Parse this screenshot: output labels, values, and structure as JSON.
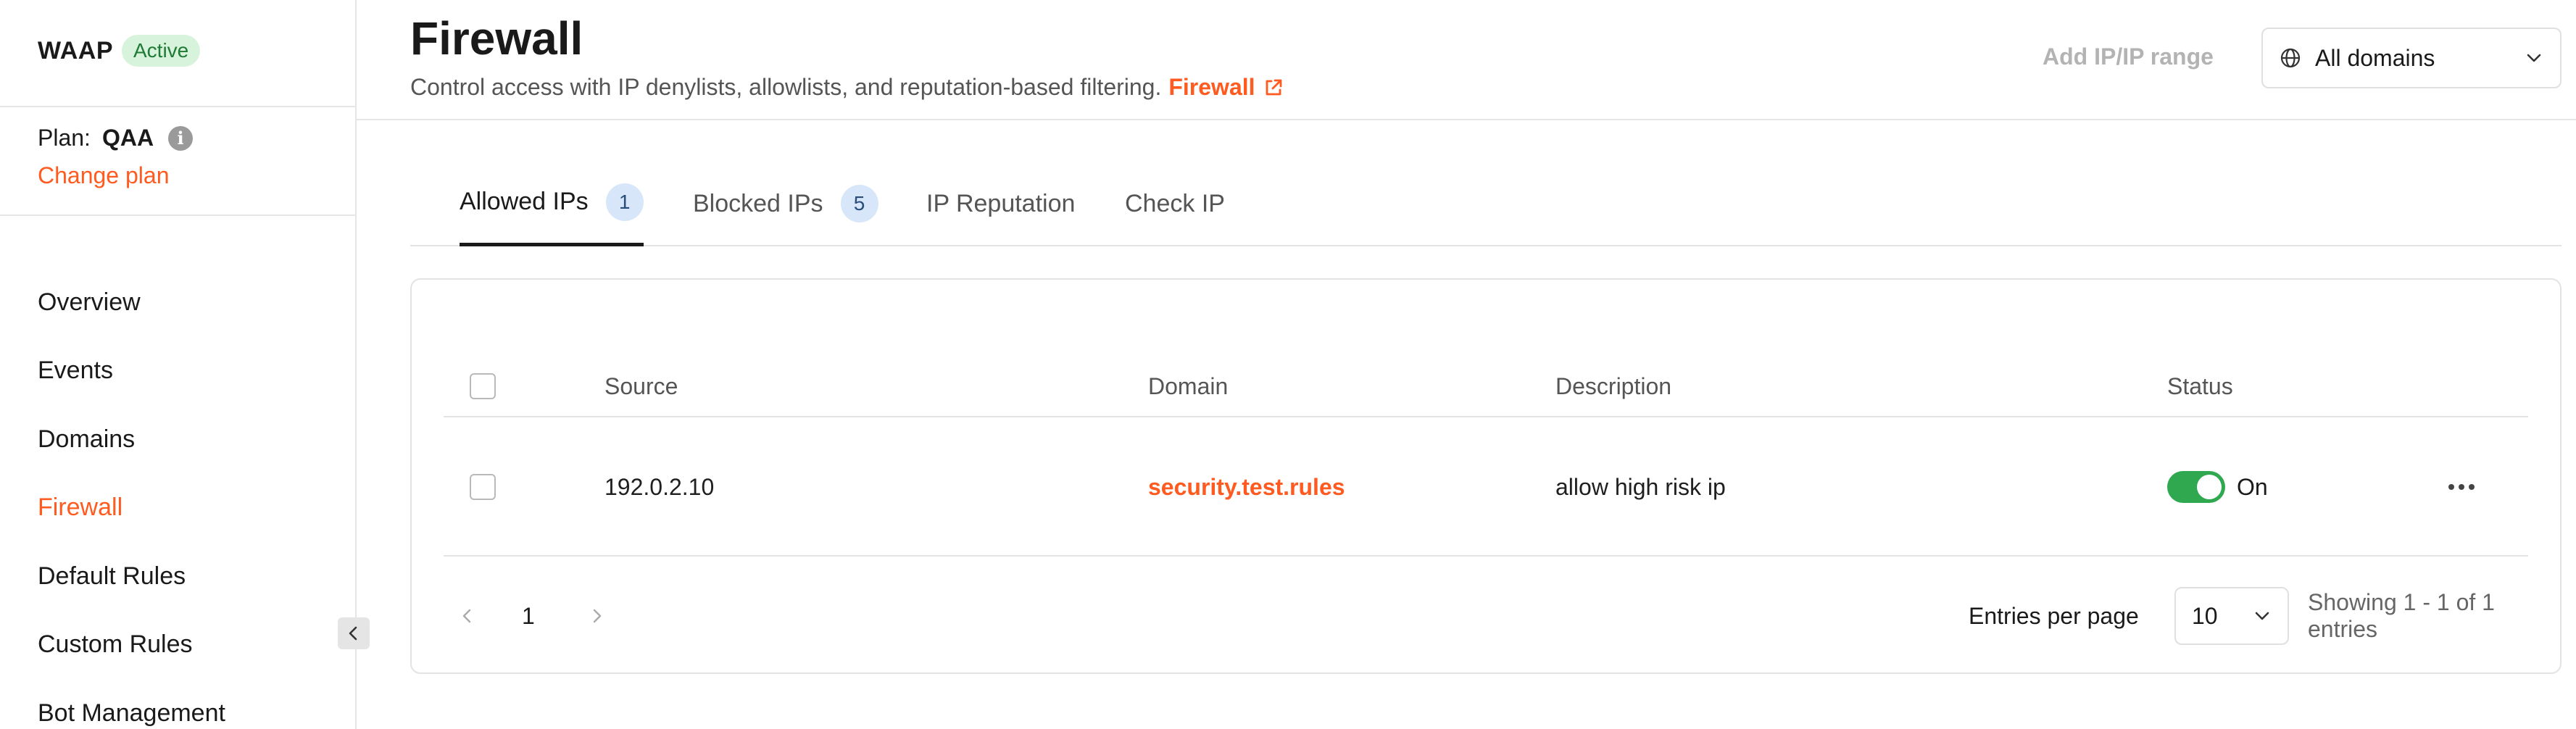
{
  "sidebar": {
    "app_name": "WAAP",
    "status_badge": "Active",
    "plan_label": "Plan:",
    "plan_value": "QAA",
    "change_plan": "Change plan",
    "nav": [
      {
        "label": "Overview"
      },
      {
        "label": "Events"
      },
      {
        "label": "Domains"
      },
      {
        "label": "Firewall"
      },
      {
        "label": "Default Rules"
      },
      {
        "label": "Custom Rules"
      },
      {
        "label": "Bot Management"
      }
    ],
    "active_item": "Firewall"
  },
  "header": {
    "title": "Firewall",
    "subtitle": "Control access with IP denylists, allowlists, and reputation-based filtering.",
    "subtitle_link": "Firewall",
    "add_button": "Add IP/IP range",
    "domain_select": "All domains"
  },
  "tabs": [
    {
      "label": "Allowed IPs",
      "count": "1"
    },
    {
      "label": "Blocked IPs",
      "count": "5"
    },
    {
      "label": "IP Reputation"
    },
    {
      "label": "Check IP"
    }
  ],
  "table": {
    "columns": [
      "Source",
      "Domain",
      "Description",
      "Status"
    ],
    "rows": [
      {
        "source": "192.0.2.10",
        "domain": "security.test.rules",
        "description": "allow high risk ip",
        "status": "On"
      }
    ]
  },
  "pagination": {
    "current_page": "1",
    "entries_label": "Entries per page",
    "entries_value": "10",
    "showing": "Showing 1 - 1 of 1 entries"
  },
  "colors": {
    "accent": "#ff5a1f",
    "toggle_on": "#2fa84f",
    "badge_bg": "#d8f3dc",
    "count_bg": "#d7e6f8"
  }
}
